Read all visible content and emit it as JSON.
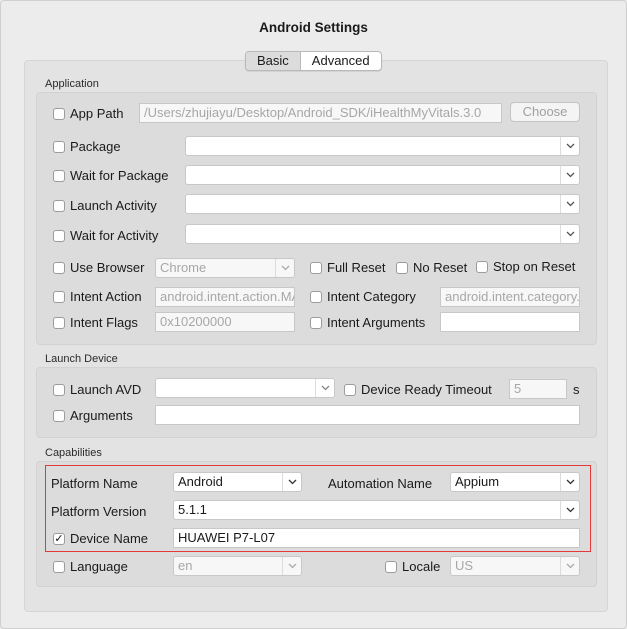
{
  "window": {
    "title": "Android Settings"
  },
  "tabs": [
    {
      "label": "Basic",
      "selected": true
    },
    {
      "label": "Advanced",
      "selected": false
    }
  ],
  "application": {
    "section_label": "Application",
    "app_path": {
      "label": "App Path",
      "checked": false,
      "value": "/Users/zhujiayu/Desktop/Android_SDK/iHealthMyVitals.3.0",
      "button": "Choose"
    },
    "package": {
      "label": "Package",
      "checked": false,
      "value": ""
    },
    "wait_for_package": {
      "label": "Wait for Package",
      "checked": false,
      "value": ""
    },
    "launch_activity": {
      "label": "Launch Activity",
      "checked": false,
      "value": ""
    },
    "wait_for_activity": {
      "label": "Wait for Activity",
      "checked": false,
      "value": ""
    },
    "use_browser": {
      "label": "Use Browser",
      "checked": false,
      "value": "Chrome"
    },
    "full_reset": {
      "label": "Full Reset",
      "checked": false
    },
    "no_reset": {
      "label": "No Reset",
      "checked": false
    },
    "stop_on_reset": {
      "label": "Stop on Reset",
      "checked": false
    },
    "intent_action": {
      "label": "Intent Action",
      "checked": false,
      "placeholder": "android.intent.action.MAIN"
    },
    "intent_category": {
      "label": "Intent Category",
      "checked": false,
      "placeholder": "android.intent.category.LAUNCHER"
    },
    "intent_flags": {
      "label": "Intent Flags",
      "checked": false,
      "placeholder": "0x10200000"
    },
    "intent_arguments": {
      "label": "Intent Arguments",
      "checked": false,
      "value": ""
    }
  },
  "launch_device": {
    "section_label": "Launch Device",
    "launch_avd": {
      "label": "Launch AVD",
      "checked": false,
      "value": ""
    },
    "device_ready_timeout": {
      "label": "Device Ready Timeout",
      "checked": false,
      "placeholder": "5",
      "unit": "s"
    },
    "arguments": {
      "label": "Arguments",
      "checked": false,
      "value": ""
    }
  },
  "capabilities": {
    "section_label": "Capabilities",
    "platform_name": {
      "label": "Platform Name",
      "value": "Android"
    },
    "automation_name": {
      "label": "Automation Name",
      "value": "Appium"
    },
    "platform_version": {
      "label": "Platform Version",
      "value": "5.1.1"
    },
    "device_name": {
      "label": "Device Name",
      "checked": true,
      "value": "HUAWEI P7-L07"
    },
    "language": {
      "label": "Language",
      "checked": false,
      "value": "en"
    },
    "locale": {
      "label": "Locale",
      "checked": false,
      "value": "US"
    }
  },
  "colors": {
    "highlight_border": "#e23a3a",
    "window_bg": "#ececec"
  },
  "icons": {
    "dropdown": "chevron-down-icon",
    "checkmark": "checkmark-icon"
  }
}
